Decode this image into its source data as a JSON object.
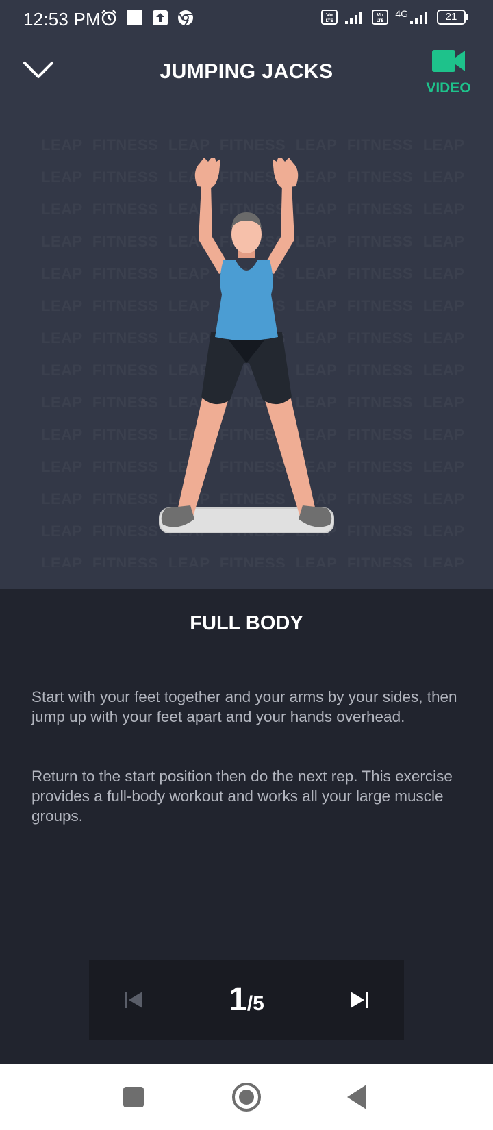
{
  "status_bar": {
    "time": "12:53 PM",
    "battery": "21",
    "network": "4G",
    "icons": [
      "alarm-icon",
      "square-icon",
      "upload-icon",
      "chrome-icon",
      "volte-icon",
      "signal-icon",
      "battery-icon"
    ]
  },
  "header": {
    "title": "JUMPING JACKS",
    "video_label": "VIDEO",
    "close_icon": "chevron-down-icon",
    "video_icon": "video-camera-icon"
  },
  "watermark": {
    "text": "LEAP FITNESS   LEAP FITNESS   LEAP FITNESS   LEAP FITNESS"
  },
  "section": {
    "title": "FULL BODY"
  },
  "description": {
    "paragraph_1": "Start with your feet together and your arms by your sides, then jump up with your feet apart and your hands overhead.",
    "paragraph_2": "Return to the start position then do the next rep. This exercise provides a full-body workout and works all your large muscle groups."
  },
  "pager": {
    "current": "1",
    "total": "/5"
  },
  "colors": {
    "accent": "#1ec28b",
    "top_background": "#333847",
    "bottom_background": "#21242e",
    "pager_background": "#191b22"
  }
}
